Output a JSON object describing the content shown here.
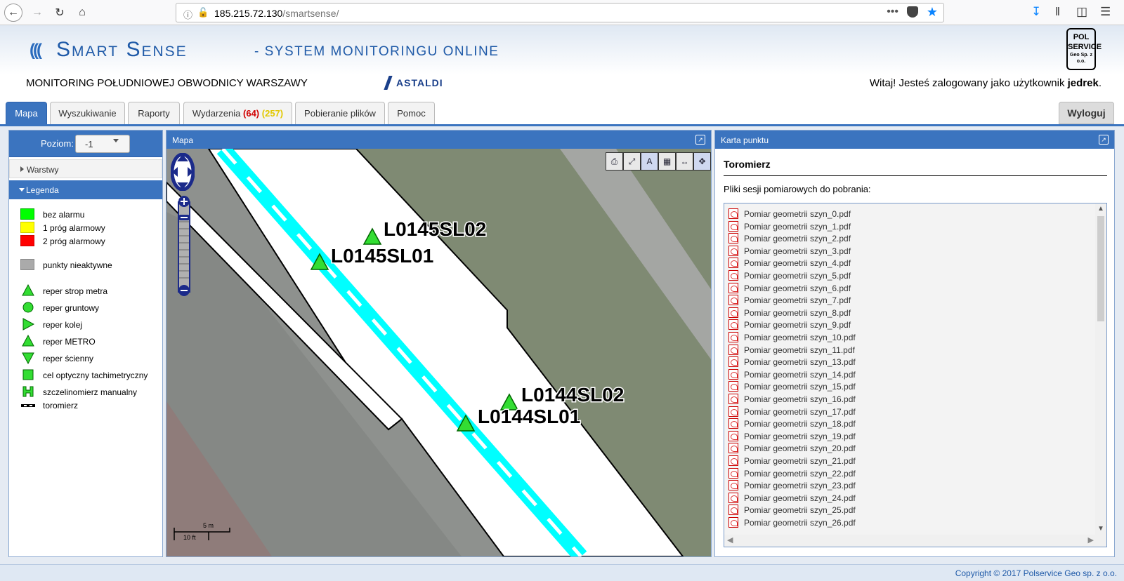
{
  "browser": {
    "url_host": "185.215.72.130",
    "url_path": "/smartsense/",
    "dots": "•••"
  },
  "header": {
    "logo_name": "Smart Sense",
    "logo_tagline": "- SYSTEM MONITORINGU ONLINE",
    "project_title": "MONITORING POŁUDNIOWEJ OBWODNICY WARSZAWY",
    "partner_logo": "ASTALDI",
    "company_logo_lines": [
      "POL",
      "SERVICE",
      "Geo Sp. z o.o."
    ],
    "greeting_prefix": "Witaj! Jesteś zalogowany jako użytkownik ",
    "username": "jedrek",
    "greeting_suffix": "."
  },
  "tabs": [
    {
      "label": "Mapa",
      "active": true
    },
    {
      "label": "Wyszukiwanie"
    },
    {
      "label": "Raporty"
    },
    {
      "label": "Wydarzenia",
      "count_red": "(64)",
      "count_yellow": "(257)"
    },
    {
      "label": "Pobieranie plików"
    },
    {
      "label": "Pomoc"
    }
  ],
  "logout_label": "Wyloguj",
  "left_panel": {
    "level_label": "Poziom:",
    "level_value": "-1",
    "layers_label": "Warstwy",
    "legend_label": "Legenda",
    "legend": [
      {
        "label": "bez alarmu",
        "color": "#00ff00"
      },
      {
        "label": "1 próg alarmowy",
        "color": "#ffff00"
      },
      {
        "label": "2 próg alarmowy",
        "color": "#ff0000"
      },
      {
        "label": "punkty nieaktywne",
        "color": "#aaaaaa"
      },
      {
        "label": "reper strop metra",
        "icon": "triangle-up-icon"
      },
      {
        "label": "reper gruntowy",
        "icon": "circle-icon"
      },
      {
        "label": "reper kolej",
        "icon": "triangle-right-icon"
      },
      {
        "label": "reper METRO",
        "icon": "triangle-up-icon"
      },
      {
        "label": "reper ścienny",
        "icon": "triangle-down-icon"
      },
      {
        "label": "cel optyczny tachimetryczny",
        "icon": "square-icon"
      },
      {
        "label": "szczelinomierz manualny",
        "icon": "h-bracket-icon"
      },
      {
        "label": "toromierz",
        "icon": "dashed-line-icon"
      }
    ]
  },
  "map_panel": {
    "title": "Mapa",
    "points": [
      "L0145SL02",
      "L0145SL01",
      "L0144SL02",
      "L0144SL01"
    ],
    "scale_metric": "5 m",
    "scale_imperial": "10 ft",
    "toolbar_icons": [
      "print-icon",
      "zoom-box-icon",
      "add-label-icon",
      "layer-select-icon",
      "measure-icon",
      "pan-icon"
    ]
  },
  "card_panel": {
    "title": "Karta punktu",
    "point_name": "Toromierz",
    "files_label": "Pliki sesji pomiarowych do pobrania:",
    "files": [
      "Pomiar geometrii szyn_0.pdf",
      "Pomiar geometrii szyn_1.pdf",
      "Pomiar geometrii szyn_2.pdf",
      "Pomiar geometrii szyn_3.pdf",
      "Pomiar geometrii szyn_4.pdf",
      "Pomiar geometrii szyn_5.pdf",
      "Pomiar geometrii szyn_6.pdf",
      "Pomiar geometrii szyn_7.pdf",
      "Pomiar geometrii szyn_8.pdf",
      "Pomiar geometrii szyn_9.pdf",
      "Pomiar geometrii szyn_10.pdf",
      "Pomiar geometrii szyn_11.pdf",
      "Pomiar geometrii szyn_13.pdf",
      "Pomiar geometrii szyn_14.pdf",
      "Pomiar geometrii szyn_15.pdf",
      "Pomiar geometrii szyn_16.pdf",
      "Pomiar geometrii szyn_17.pdf",
      "Pomiar geometrii szyn_18.pdf",
      "Pomiar geometrii szyn_19.pdf",
      "Pomiar geometrii szyn_20.pdf",
      "Pomiar geometrii szyn_21.pdf",
      "Pomiar geometrii szyn_22.pdf",
      "Pomiar geometrii szyn_23.pdf",
      "Pomiar geometrii szyn_24.pdf",
      "Pomiar geometrii szyn_25.pdf",
      "Pomiar geometrii szyn_26.pdf"
    ]
  },
  "footer": {
    "copyright": "Copyright © 2017 Polservice Geo sp. z o.o."
  },
  "colors": {
    "accent": "#3b74bf",
    "alarm_red": "#d10000",
    "alarm_yellow": "#e2c800",
    "track": "#00ffff",
    "ok_green": "#33dd33"
  }
}
